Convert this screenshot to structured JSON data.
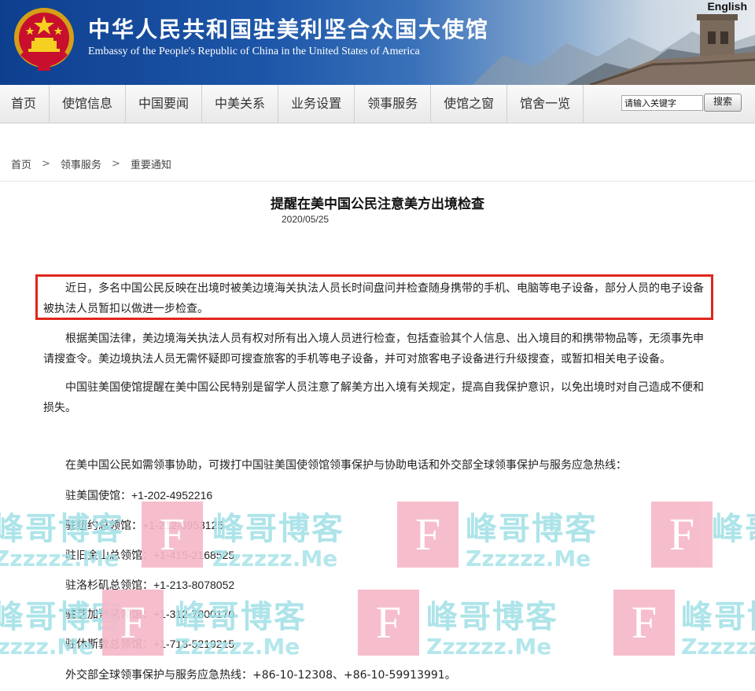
{
  "header": {
    "title_zh": "中华人民共和国驻美利坚合众国大使馆",
    "title_en": "Embassy of the People's Republic of China in the United States of America",
    "lang_link": "English"
  },
  "nav": {
    "items": [
      "首页",
      "使馆信息",
      "中国要闻",
      "中美关系",
      "业务设置",
      "领事服务",
      "使馆之窗",
      "馆舍一览"
    ]
  },
  "search": {
    "value": "请输入关键字",
    "button": "搜索"
  },
  "breadcrumb": {
    "items": [
      "首页",
      "领事服务",
      "重要通知"
    ],
    "separator": ">"
  },
  "article": {
    "title": "提醒在美中国公民注意美方出境检查",
    "date": "2020/05/25",
    "paragraphs": [
      "近日，多名中国公民反映在出境时被美边境海关执法人员长时间盘问并检查随身携带的手机、电脑等电子设备，部分人员的电子设备被执法人员暂扣以做进一步检查。",
      "根据美国法律，美边境海关执法人员有权对所有出入境人员进行检查，包括查验其个人信息、出入境目的和携带物品等，无须事先申请搜查令。美边境执法人员无需怀疑即可搜查旅客的手机等电子设备，并可对旅客电子设备进行升级搜查，或暂扣相关电子设备。",
      "中国驻美国使馆提醒在美中国公民特别是留学人员注意了解美方出入境有关规定，提高自我保护意识，以免出境时对自己造成不便和损失。"
    ],
    "contact_intro": "在美中国公民如需领事协助，可拨打中国驻美国使领馆领事保护与协助电话和外交部全球领事保护与服务应急热线：",
    "contacts": [
      {
        "label": "驻美国使馆：",
        "phone": "+1-202-4952216"
      },
      {
        "label": "驻纽约总领馆：",
        "phone": "+1-212-6953125"
      },
      {
        "label": "驻旧金山总领馆：",
        "phone": "+1-415-2168525"
      },
      {
        "label": "驻洛杉矶总领馆：",
        "phone": "+1-213-8078052"
      },
      {
        "label": "驻芝加哥总领馆：",
        "phone": "+1-312-7800170"
      },
      {
        "label": "驻休斯敦总领馆：",
        "phone": "+1-713-5219215"
      }
    ],
    "hotline": "外交部全球领事保护与服务应急热线：+86-10-12308、+86-10-59913991。"
  },
  "watermark": {
    "letter": "F",
    "text": "峰哥博客",
    "sub": "Zzzzzz.Me"
  },
  "colors": {
    "banner_blue": "#1d56a8",
    "highlight_red": "#e0261c",
    "watermark_pink": "#f6b8c8",
    "watermark_cyan": "#9fe0e6"
  }
}
